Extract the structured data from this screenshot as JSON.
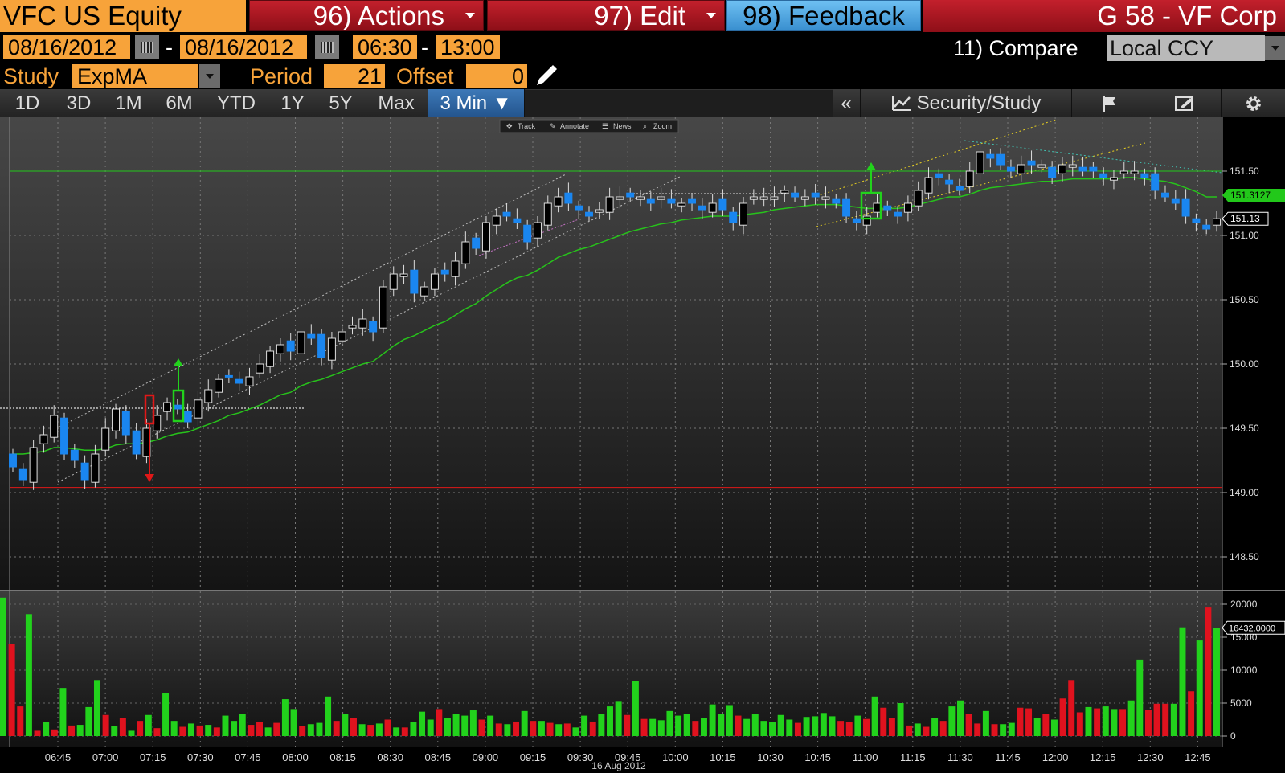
{
  "header": {
    "ticker": "VFC US Equity",
    "actions_label": "96) Actions",
    "edit_label": "97) Edit",
    "feedback_label": "98) Feedback",
    "security_name": "G 58 - VF Corp"
  },
  "range": {
    "start_date": "08/16/2012",
    "dash1": "-",
    "end_date": "08/16/2012",
    "start_time": "06:30",
    "dash2": "-",
    "end_time": "13:00",
    "compare_label": "11) Compare",
    "currency": "Local CCY"
  },
  "study": {
    "label": "Study",
    "value": "ExpMA",
    "period_label": "Period",
    "period_value": "21",
    "offset_label": "Offset",
    "offset_value": "0"
  },
  "tabs": [
    {
      "label": "1D"
    },
    {
      "label": "3D"
    },
    {
      "label": "1M"
    },
    {
      "label": "6M"
    },
    {
      "label": "YTD"
    },
    {
      "label": "1Y"
    },
    {
      "label": "5Y"
    },
    {
      "label": "Max"
    },
    {
      "label": "3 Min ▼"
    }
  ],
  "toolbar": {
    "collapse_label": "«",
    "security_study_label": "Security/Study",
    "flag_icon": "flag-icon",
    "annotate_icon": "pen-icon",
    "settings_icon": "gear-icon"
  },
  "mini_toolbar": {
    "track": "Track",
    "annotate": "Annotate",
    "news": "News",
    "zoom": "Zoom"
  },
  "colors": {
    "up_candle": "#000000",
    "down_candle": "#1a86f0",
    "ema_line": "#27c21b",
    "volume_up": "#22d21c",
    "volume_down": "#e0121e",
    "amber": "#f7a33a"
  },
  "chart_data": [
    {
      "type": "candlestick",
      "title": "",
      "xlabel": "16 Aug 2012",
      "x_ticks": [
        "06:45",
        "07:00",
        "07:15",
        "07:30",
        "07:45",
        "08:00",
        "08:15",
        "08:30",
        "08:45",
        "09:00",
        "09:15",
        "09:30",
        "09:45",
        "10:00",
        "10:15",
        "10:30",
        "10:45",
        "11:00",
        "11:15",
        "11:30",
        "11:45",
        "12:00",
        "12:15",
        "12:30",
        "12:45"
      ],
      "y_ticks": [
        "151.50",
        "151.00",
        "150.50",
        "150.00",
        "149.50",
        "149.00",
        "148.50"
      ],
      "ylim": [
        148.35,
        151.85
      ],
      "price_marker_ema": "151.3127",
      "price_marker_last": "151.13",
      "horizontal_lines": [
        151.5,
        149.04
      ],
      "close": [
        149.2,
        149.1,
        149.35,
        149.45,
        149.6,
        149.3,
        149.25,
        149.1,
        149.3,
        149.5,
        149.65,
        149.45,
        149.3,
        149.5,
        149.6,
        149.7,
        149.65,
        149.55,
        149.72,
        149.8,
        149.88,
        149.9,
        149.85,
        149.9,
        150.0,
        150.1,
        150.15,
        150.1,
        150.25,
        150.2,
        150.05,
        150.2,
        150.25,
        150.3,
        150.35,
        150.25,
        150.6,
        150.7,
        150.7,
        150.55,
        150.6,
        150.7,
        150.7,
        150.8,
        150.95,
        150.9,
        151.1,
        151.15,
        151.15,
        151.1,
        150.95,
        151.1,
        151.25,
        151.3,
        151.25,
        151.2,
        151.15,
        151.2,
        151.3,
        151.3,
        151.3,
        151.3,
        151.25,
        151.3,
        151.25,
        151.25,
        151.25,
        151.2,
        151.25,
        151.2,
        151.1,
        151.25,
        151.3,
        151.3,
        151.3,
        151.35,
        151.3,
        151.3,
        151.3,
        151.3,
        151.25,
        151.15,
        151.1,
        151.15,
        151.25,
        151.2,
        151.15,
        151.25,
        151.35,
        151.45,
        151.45,
        151.4,
        151.35,
        151.5,
        151.65,
        151.6,
        151.55,
        151.5,
        151.55,
        151.55,
        151.55,
        151.45,
        151.55,
        151.55,
        151.5,
        151.5,
        151.45,
        151.45,
        151.5,
        151.5,
        151.45,
        151.35,
        151.3,
        151.25,
        151.15,
        151.1,
        151.05,
        151.13
      ],
      "ema": [
        149.3,
        149.3,
        149.31,
        149.32,
        149.35,
        149.35,
        149.34,
        149.33,
        149.33,
        149.34,
        149.37,
        149.38,
        149.38,
        149.39,
        149.41,
        149.44,
        149.46,
        149.47,
        149.5,
        149.53,
        149.56,
        149.6,
        149.62,
        149.65,
        149.68,
        149.72,
        149.76,
        149.78,
        149.83,
        149.86,
        149.88,
        149.91,
        149.94,
        149.97,
        150.0,
        150.02,
        150.08,
        150.14,
        150.19,
        150.22,
        150.26,
        150.3,
        150.33,
        150.38,
        150.43,
        150.47,
        150.53,
        150.58,
        150.63,
        150.67,
        150.69,
        150.73,
        150.78,
        150.83,
        150.86,
        150.89,
        150.91,
        150.94,
        150.97,
        151.0,
        151.03,
        151.05,
        151.07,
        151.09,
        151.1,
        151.12,
        151.13,
        151.14,
        151.15,
        151.15,
        151.15,
        151.16,
        151.17,
        151.18,
        151.2,
        151.21,
        151.22,
        151.23,
        151.24,
        151.24,
        151.24,
        151.23,
        151.22,
        151.21,
        151.21,
        151.21,
        151.21,
        151.22,
        151.24,
        151.26,
        151.28,
        151.3,
        151.3,
        151.32,
        151.35,
        151.37,
        151.38,
        151.39,
        151.4,
        151.41,
        151.42,
        151.42,
        151.43,
        151.44,
        151.44,
        151.44,
        151.44,
        151.44,
        151.45,
        151.45,
        151.44,
        151.43,
        151.42,
        151.4,
        151.37,
        151.34,
        151.3,
        151.3
      ]
    },
    {
      "type": "bar",
      "title": "",
      "y_ticks": [
        "20000",
        "15000",
        "10000",
        "5000",
        "0"
      ],
      "ylim": [
        0,
        21000
      ],
      "last_value_marker": "16432.0000",
      "values": [
        21000,
        14000,
        4500,
        18500,
        800,
        2100,
        1000,
        7300,
        1600,
        1700,
        4400,
        8500,
        3200,
        1500,
        2800,
        800,
        2300,
        3200,
        1200,
        6500,
        2300,
        1400,
        1900,
        1600,
        1700,
        1300,
        3100,
        2300,
        3400,
        1700,
        2100,
        1300,
        2000,
        5600,
        4100,
        1500,
        1800,
        2000,
        6000,
        2300,
        3300,
        2700,
        1800,
        1700,
        1900,
        2500,
        1300,
        1300,
        2100,
        3700,
        2500,
        4100,
        2700,
        3300,
        3100,
        3900,
        2500,
        3100,
        1900,
        1800,
        2200,
        3800,
        2300,
        2300,
        2000,
        1800,
        1900,
        1300,
        3100,
        2200,
        3400,
        4500,
        5200,
        3200,
        8400,
        2600,
        2600,
        2400,
        3800,
        3100,
        3300,
        2300,
        2800,
        4800,
        3300,
        4700,
        3100,
        2600,
        3400,
        2300,
        2100,
        3200,
        2500,
        2000,
        2900,
        3000,
        3500,
        3000,
        2300,
        2100,
        3100,
        2600,
        6000,
        4300,
        2800,
        5000,
        1600,
        1900,
        1400,
        2700,
        2300,
        4500,
        5400,
        3300,
        1900,
        3800,
        1800,
        1800,
        2000,
        4300,
        4200,
        2800,
        3300,
        2500,
        5700,
        8500,
        3600,
        4400,
        4200,
        4500,
        4100,
        4100,
        5400,
        11600,
        4000,
        4900,
        4900,
        4900,
        16500,
        6800,
        14500,
        19500,
        16432
      ],
      "up": [
        true,
        false,
        false,
        true,
        false,
        true,
        false,
        true,
        false,
        true,
        true,
        true,
        false,
        true,
        false,
        true,
        false,
        true,
        false,
        true,
        true,
        false,
        true,
        false,
        true,
        false,
        true,
        true,
        true,
        false,
        false,
        true,
        false,
        true,
        true,
        false,
        true,
        true,
        true,
        false,
        true,
        false,
        true,
        false,
        true,
        false,
        true,
        false,
        true,
        true,
        true,
        false,
        true,
        true,
        true,
        true,
        false,
        true,
        false,
        true,
        false,
        true,
        false,
        true,
        false,
        true,
        false,
        true,
        true,
        false,
        true,
        true,
        true,
        false,
        true,
        false,
        true,
        true,
        true,
        true,
        true,
        false,
        true,
        true,
        true,
        true,
        false,
        true,
        true,
        true,
        true,
        true,
        true,
        false,
        true,
        true,
        true,
        true,
        false,
        false,
        true,
        false,
        true,
        false,
        false,
        true,
        false,
        true,
        false,
        true,
        false,
        true,
        true,
        false,
        false,
        true,
        false,
        true,
        true,
        false,
        false,
        true,
        false,
        true,
        false,
        false,
        false,
        true,
        false,
        true,
        true,
        false,
        true,
        true,
        false,
        false,
        false,
        true,
        true,
        false,
        true,
        false,
        true,
        false
      ]
    }
  ]
}
